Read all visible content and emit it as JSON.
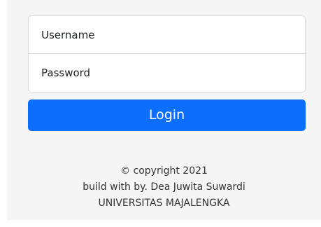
{
  "form": {
    "username_placeholder": "Username",
    "password_placeholder": "Password",
    "login_label": "Login"
  },
  "footer": {
    "copyright": "© copyright 2021",
    "credit": "build with by. Dea Juwita Suwardi",
    "institution": "UNIVERSITAS MAJALENGKA"
  },
  "colors": {
    "primary": "#0d6efd",
    "panel_background": "#f5f5f5",
    "text": "#333333"
  }
}
